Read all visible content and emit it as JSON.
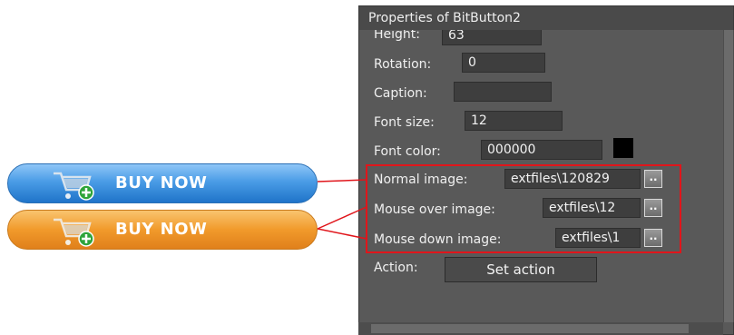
{
  "window": {
    "title": "Properties of BitButton2"
  },
  "buttons": [
    {
      "label": "BUY NOW",
      "color": "#4a9ce6"
    },
    {
      "label": "BUY NOW",
      "color": "#f19a2b"
    }
  ],
  "properties": {
    "height": {
      "label": "Height:",
      "value": "63"
    },
    "rotation": {
      "label": "Rotation:",
      "value": "0"
    },
    "caption": {
      "label": "Caption:",
      "value": ""
    },
    "font_size": {
      "label": "Font size:",
      "value": "12"
    },
    "font_color": {
      "label": "Font color:",
      "value": "000000",
      "swatch": "#000000"
    },
    "normal_image": {
      "label": "Normal image:",
      "value": "extfiles\\120829",
      "browse": ".."
    },
    "mouse_over_image": {
      "label": "Mouse over image:",
      "value": "extfiles\\12",
      "browse": ".."
    },
    "mouse_down_image": {
      "label": "Mouse down image:",
      "value": "extfiles\\1",
      "browse": ".."
    },
    "action": {
      "label": "Action:",
      "button": "Set action"
    }
  },
  "colors": {
    "highlight": "#e0151b",
    "panel_bg": "#595959"
  }
}
